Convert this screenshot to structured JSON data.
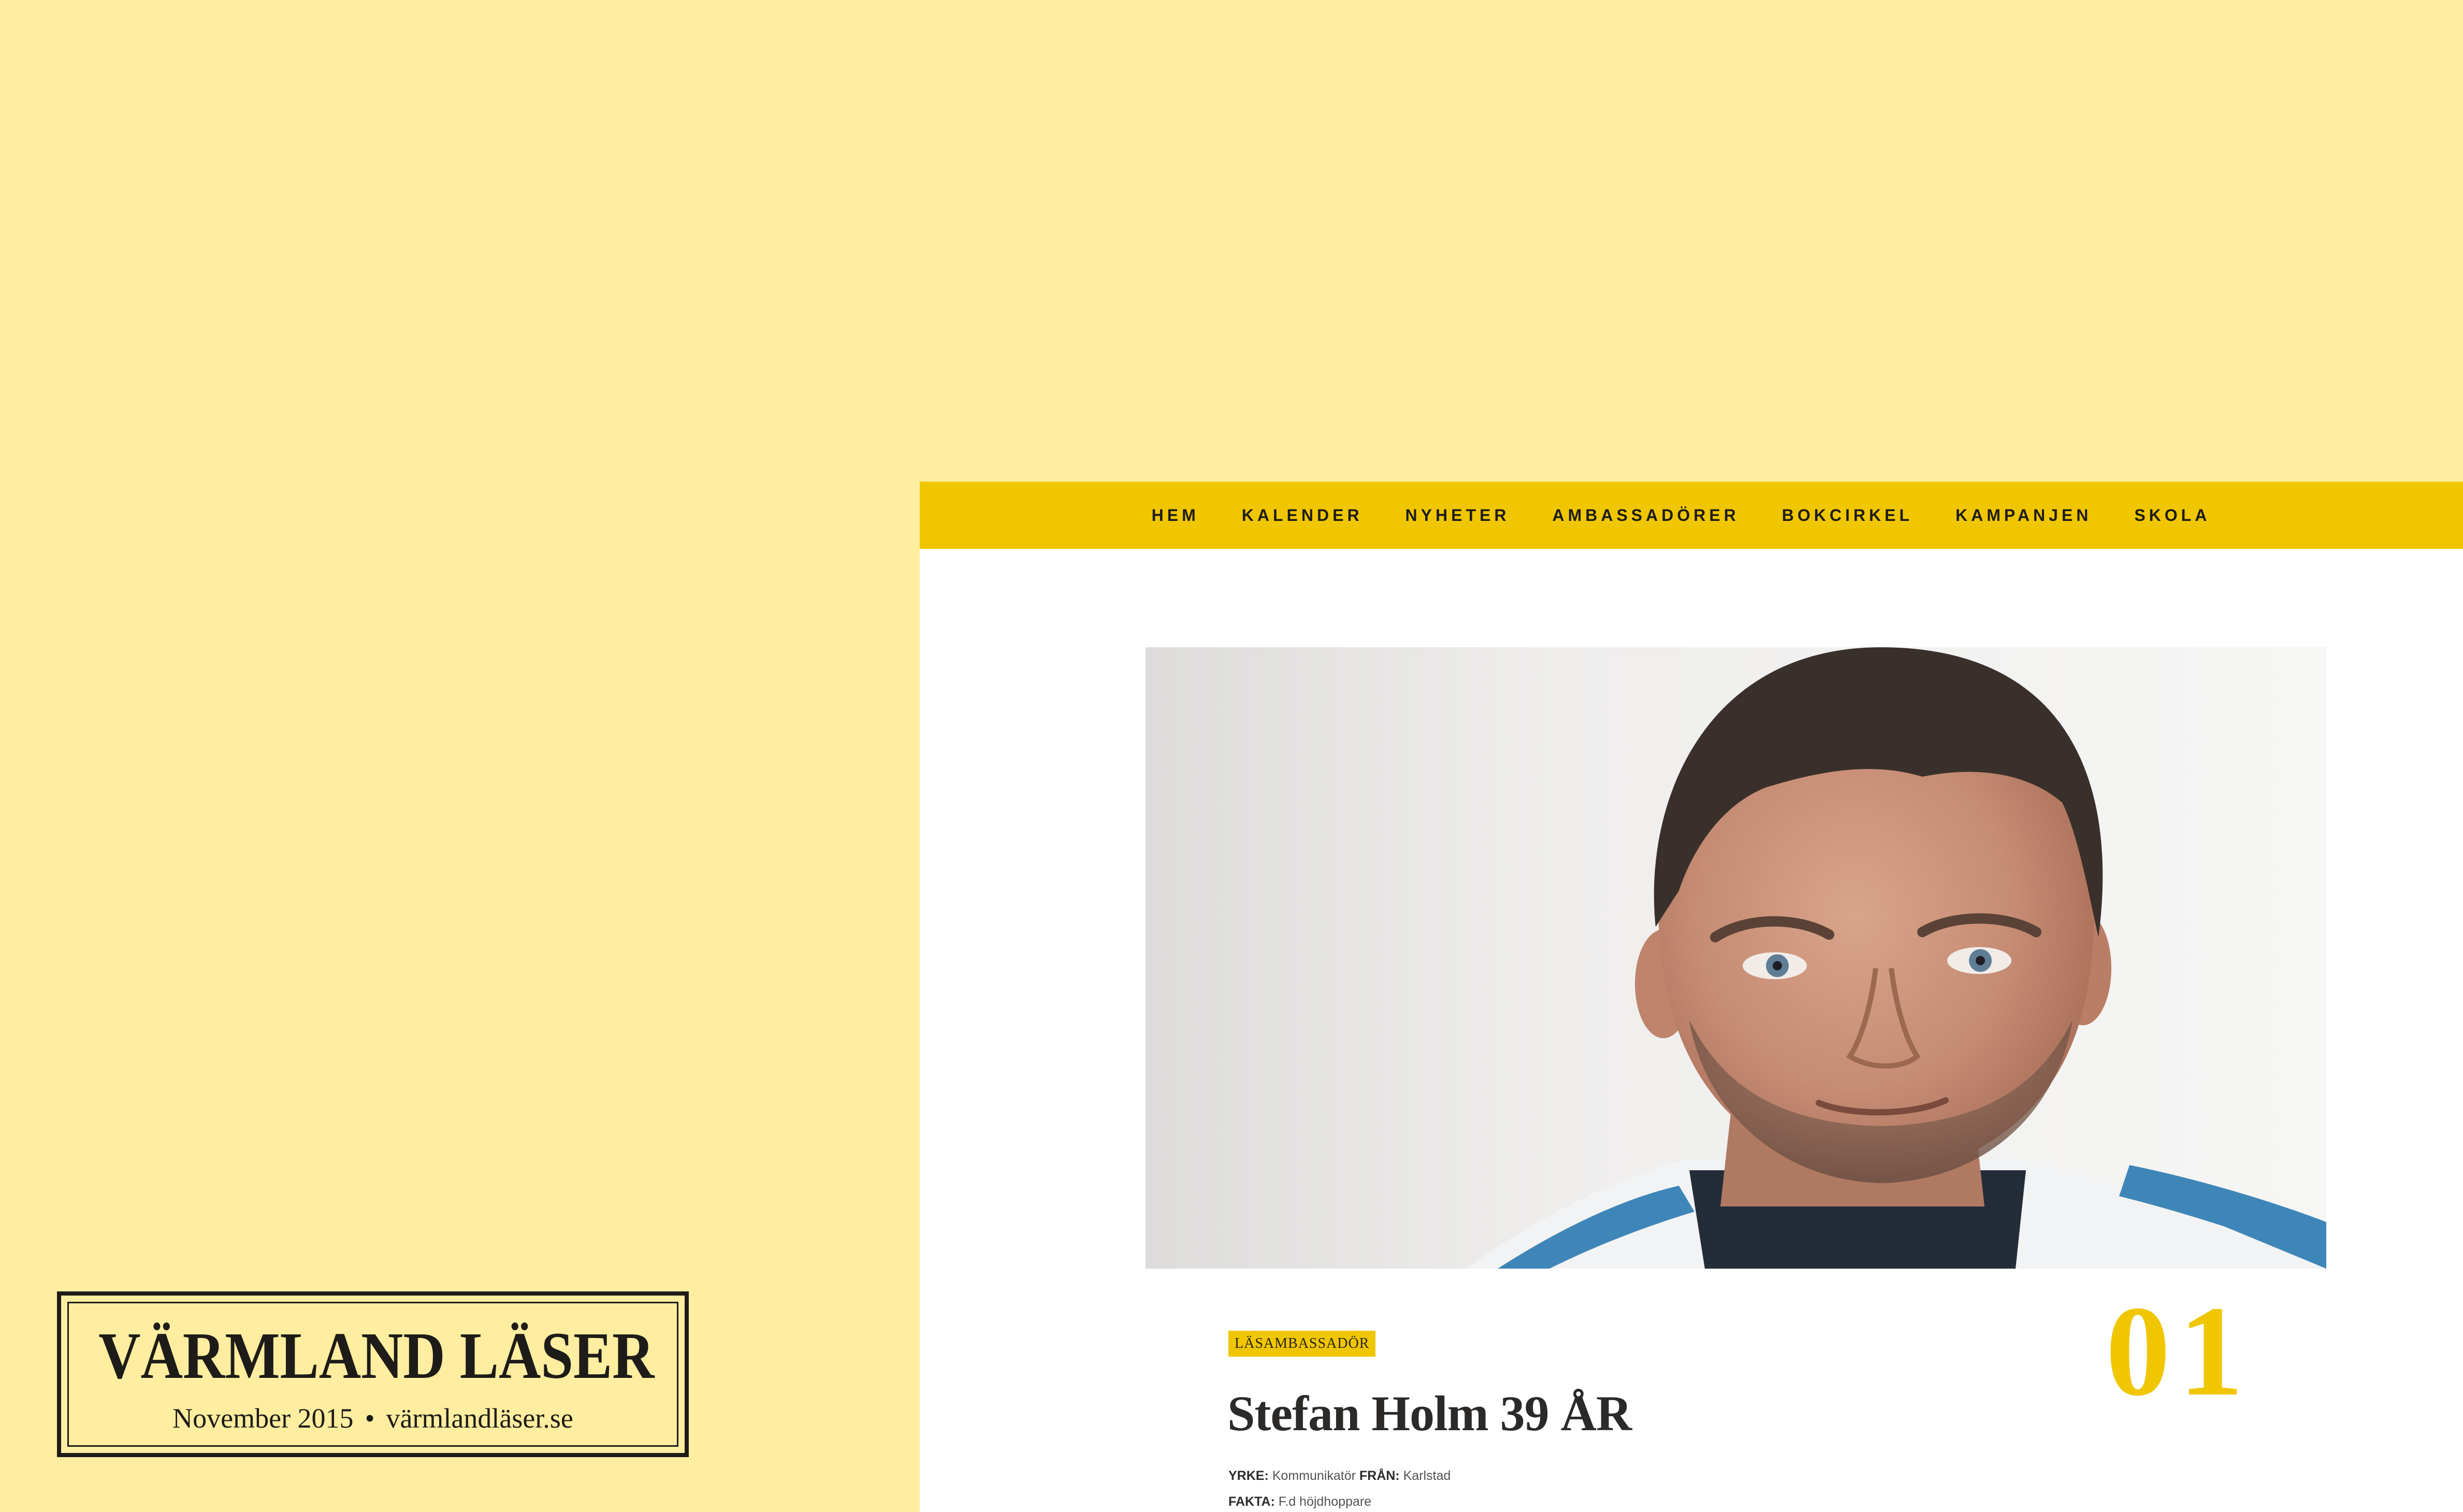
{
  "nav": {
    "items": [
      {
        "label": "HEM"
      },
      {
        "label": "KALENDER"
      },
      {
        "label": "NYHETER"
      },
      {
        "label": "AMBASSADÖRER"
      },
      {
        "label": "BOKCIRKEL"
      },
      {
        "label": "KAMPANJEN"
      },
      {
        "label": "SKOLA"
      }
    ]
  },
  "article": {
    "category": "LÄSAMBASSADÖR",
    "title": "Stefan Holm 39 ÅR",
    "number": "01",
    "facts": {
      "yrke_label": "YRKE:",
      "yrke_value": "Kommunikatör",
      "fran_label": "FRÅN:",
      "fran_value": "Karlstad",
      "fakta_label": "FAKTA:",
      "fakta_value": "F.d höjdhoppare"
    }
  },
  "stamp": {
    "title": "VÄRMLAND LÄSER",
    "date": "November 2015",
    "separator": "•",
    "url": "värmlandläser.se"
  },
  "colors": {
    "background": "#FFEDA0",
    "accent": "#F0C600",
    "text_dark": "#1E1C16"
  }
}
